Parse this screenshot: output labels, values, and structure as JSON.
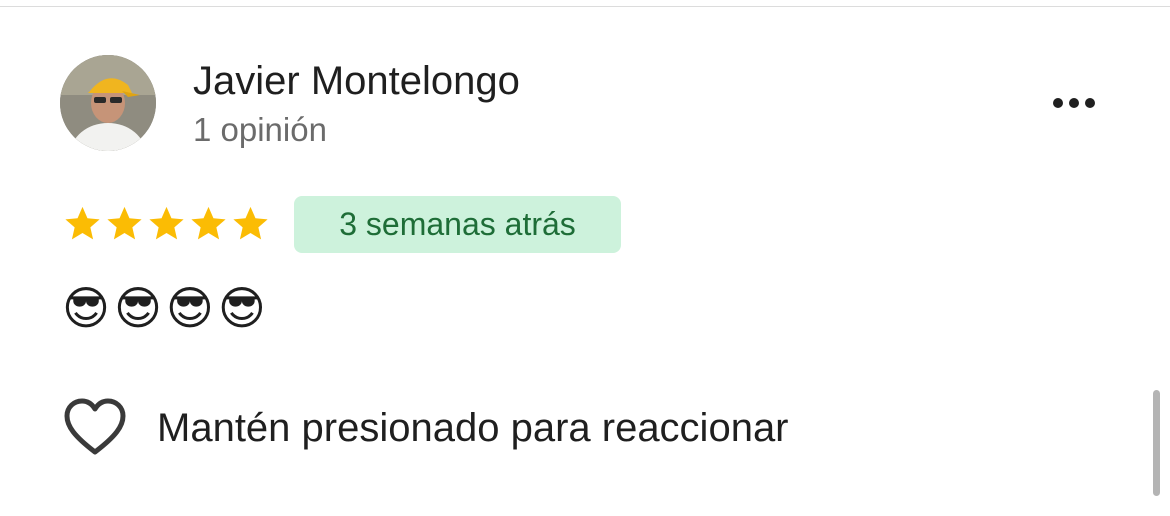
{
  "review": {
    "reviewer_name": "Javier Montelongo",
    "review_count": "1 opinión",
    "rating": 5,
    "rating_max": 5,
    "time_ago": "3 semanas atrás",
    "text": "😎😎😎😎"
  },
  "actions": {
    "react_label": "Mantén presionado para reaccionar",
    "more_icon": "more-horizontal-icon",
    "react_icon": "heart-outline-icon"
  },
  "colors": {
    "star": "#fbbc04",
    "badge_bg": "#cdf2dc",
    "badge_text": "#1e6d37"
  }
}
